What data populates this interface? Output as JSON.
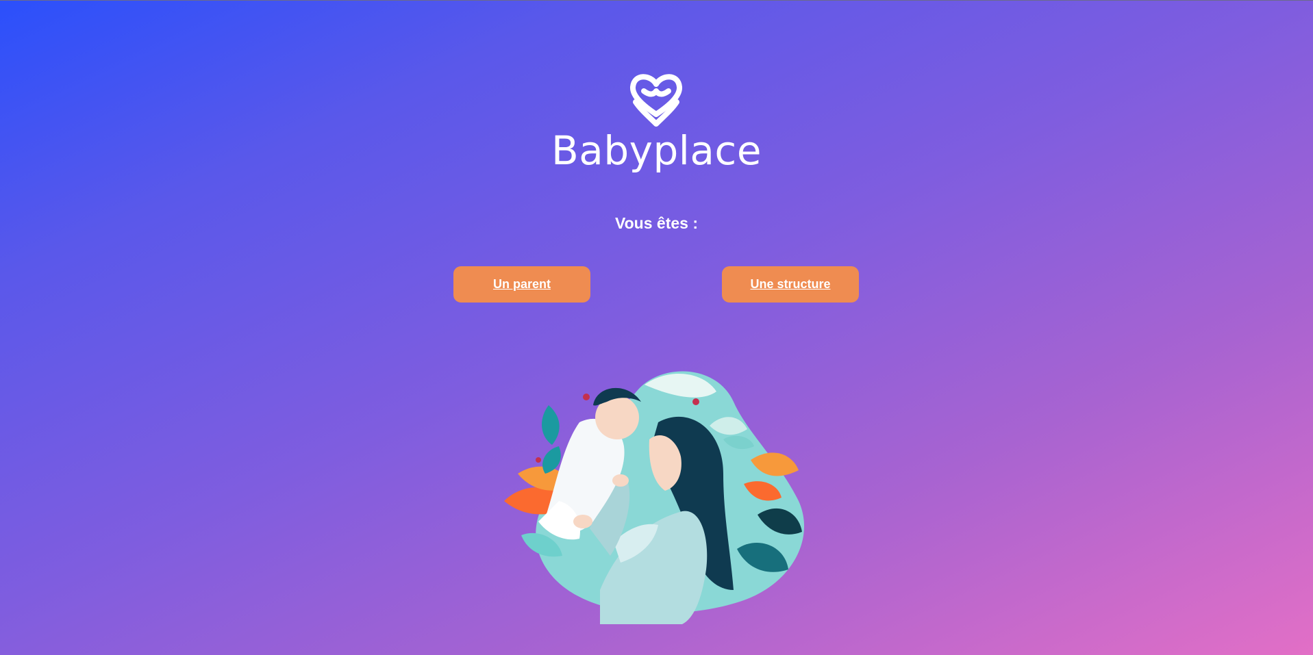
{
  "brand": {
    "name": "Babyplace",
    "logo_icon": "heart-logo-icon"
  },
  "prompt": {
    "question": "Vous êtes :"
  },
  "choices": {
    "parent_label": "Un parent",
    "structure_label": "Une structure"
  },
  "colors": {
    "gradient_start": "#2b50fb",
    "gradient_end": "#e26fc6",
    "button_bg": "#ef8c51",
    "text": "#ffffff"
  },
  "illustration": {
    "icon": "mother-and-baby-illustration"
  }
}
